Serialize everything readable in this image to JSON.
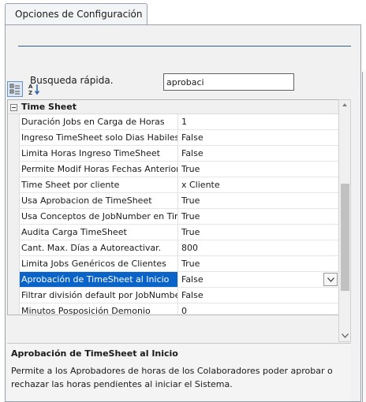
{
  "tab": {
    "label": "Opciones de Configuración"
  },
  "search": {
    "label": "Busqueda rápida.",
    "value": "aprobaci"
  },
  "toolbar": {
    "categorized_icon": "categorized-view-icon",
    "sort_icon": "sort-az-icon"
  },
  "grid": {
    "category": "Time Sheet",
    "rows": [
      {
        "name": "Duración Jobs en Carga de Horas",
        "value": "1"
      },
      {
        "name": "Ingreso TimeSheet solo Dias Habiles",
        "value": "False"
      },
      {
        "name": "Limita Horas Ingreso TimeSheet",
        "value": "False"
      },
      {
        "name": "Permite Modif Horas Fechas Anteriores",
        "value": "True"
      },
      {
        "name": "Time Sheet por cliente",
        "value": "x Cliente"
      },
      {
        "name": "Usa Aprobacion de TimeSheet",
        "value": "True"
      },
      {
        "name": "Usa Conceptos de JobNumber en TimeSh",
        "value": "True"
      },
      {
        "name": "Audita Carga TimeSheet",
        "value": "True"
      },
      {
        "name": "Cant. Max. Días a Autoreactivar.",
        "value": "800"
      },
      {
        "name": "Limita Jobs Genéricos de Clientes",
        "value": "True"
      },
      {
        "name": "Aprobación de TimeSheet al Inicio",
        "value": "False"
      },
      {
        "name": "Filtrar división default por JobNumber",
        "value": "False"
      },
      {
        "name": "Minutos Posposición Demonio",
        "value": "0"
      }
    ],
    "selected_row": "Aprobación de TimeSheet al Inicio"
  },
  "description": {
    "title": "Aprobación de TimeSheet al Inicio",
    "text": "Permite a los Aprobadores de horas de los Colaboradores poder aprobar o rechazar las horas pendientes al iniciar el Sistema."
  },
  "colors": {
    "selection": "#0a64c8",
    "divider": "#2f5f97"
  }
}
